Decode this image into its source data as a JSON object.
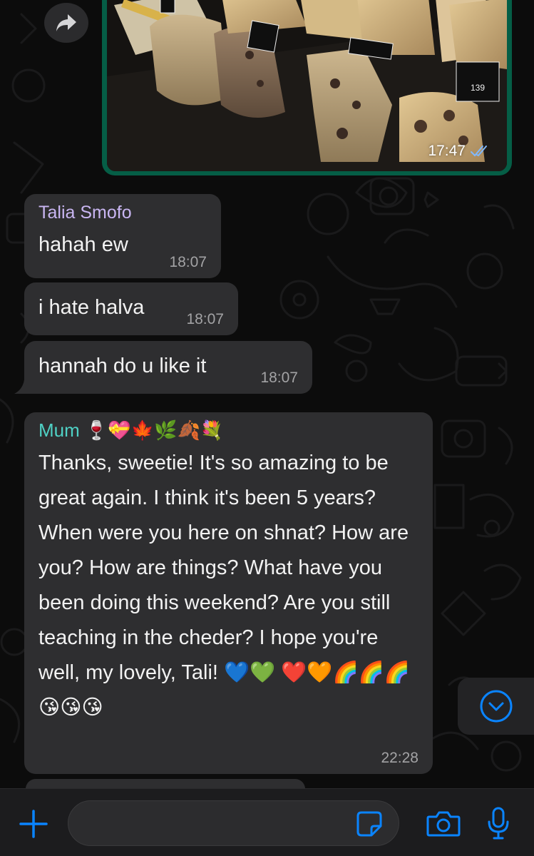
{
  "image_message": {
    "time": "17:47",
    "price_tag": "139"
  },
  "messages": [
    {
      "sender": "Talia Smofo",
      "text": "hahah ew",
      "time": "18:07"
    },
    {
      "text": "i hate halva",
      "time": "18:07"
    },
    {
      "text": "hannah do u like it",
      "time": "18:07"
    },
    {
      "sender": "Mum 🍷💝🍁🌿🍂💐",
      "text": "Thanks, sweetie! It's so amazing to be great again. I think it's been 5 years? When were you here on shnat? How are you? How are things? What have you been doing this weekend? Are you still teaching in the cheder? I hope you're well, my lovely, Tali! 💙💚 ❤️🧡🌈🌈🌈😘😘😘",
      "time": "22:28"
    }
  ],
  "colors": {
    "sender_talia": "#c9b6f2",
    "sender_mum": "#4fd1c5",
    "accent": "#0a84ff",
    "outgoing_bubble": "#055e46",
    "incoming_bubble": "#2e2e30"
  },
  "icons": {
    "forward": "forward-icon",
    "scroll_down": "chevron-down-icon",
    "add": "plus-icon",
    "sticker": "sticker-icon",
    "camera": "camera-icon",
    "mic": "microphone-icon",
    "read_receipt": "double-check-icon"
  },
  "composer": {
    "placeholder": ""
  }
}
